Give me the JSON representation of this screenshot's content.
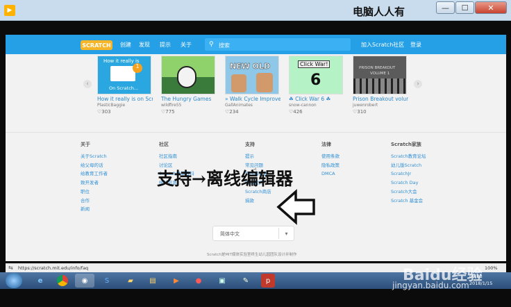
{
  "window": {
    "watermark_title": "电脑人人有",
    "min": "—",
    "max": "☐",
    "close": "✕"
  },
  "nav": {
    "logo": "SCRATCH",
    "links": [
      "创建",
      "发现",
      "提示",
      "关于"
    ],
    "search_placeholder": "搜索",
    "join": "加入Scratch社区",
    "signin": "登录"
  },
  "carousel": {
    "projects": [
      {
        "title": "How it really is on Scr",
        "author": "PlasticBaggie",
        "loves": "♡303",
        "thumb_text": "How it really is",
        "thumb_sub": "On Scratch...",
        "thumb_color": "#2aa7e0"
      },
      {
        "title": "The Hungry Games",
        "author": "wildfire55",
        "loves": "♡775",
        "thumb_text": "",
        "thumb_sub": "",
        "thumb_color": "#3a7a3a"
      },
      {
        "title": "» Walk Cycle Improve",
        "author": "GallAnimates",
        "loves": "♡234",
        "thumb_text": "NEW OLD",
        "thumb_sub": "",
        "thumb_color": "#8ec7e8"
      },
      {
        "title": "☘ Click War 6 ☘",
        "author": "snow-cannon",
        "loves": "♡426",
        "thumb_text": "Click War!",
        "thumb_sub": "6",
        "thumb_color": "#b5f2c6"
      },
      {
        "title": "Prison Breakout volun",
        "author": "juwenrobert",
        "loves": "♡310",
        "thumb_text": "PRISON BREAKOUT",
        "thumb_sub": "VOLUME 1",
        "thumb_color": "#5b5b5b"
      }
    ]
  },
  "footer": {
    "columns": [
      {
        "heading": "关于",
        "links": [
          "关于Scratch",
          "给父母的话",
          "给教育工作者",
          "致开发者",
          "职位",
          "合作",
          "新闻"
        ]
      },
      {
        "heading": "社区",
        "links": [
          "社区指南",
          "讨论区",
          "Scratch维基百科",
          "统计信息"
        ]
      },
      {
        "heading": "支持",
        "links": [
          "提示",
          "常见问题",
          "离线编辑器",
          "联系我们",
          "Scratch商店",
          "捐款"
        ]
      },
      {
        "heading": "法律",
        "links": [
          "使用条款",
          "隐私政策",
          "DMCA"
        ]
      },
      {
        "heading": "Scratch家族",
        "links": [
          "Scratch教育论坛",
          "幼儿版Scratch",
          "ScratchJr",
          "Scratch Day",
          "Scratch大会",
          "Scratch 基金会"
        ]
      }
    ],
    "language": "简体中文",
    "credit": "Scratch是MIT媒体实验室终生幼儿园团队设计并制作"
  },
  "annotation": "支持→离线编辑器",
  "statusbar": {
    "url": "https://scratch.mit.edu/info/faq",
    "zoom": "100%"
  },
  "taskbar": {
    "time": "09:03",
    "date": "2018/1/15"
  },
  "watermark": {
    "logo": "Baidu经验",
    "sub": "jingyan.baidu.com"
  }
}
